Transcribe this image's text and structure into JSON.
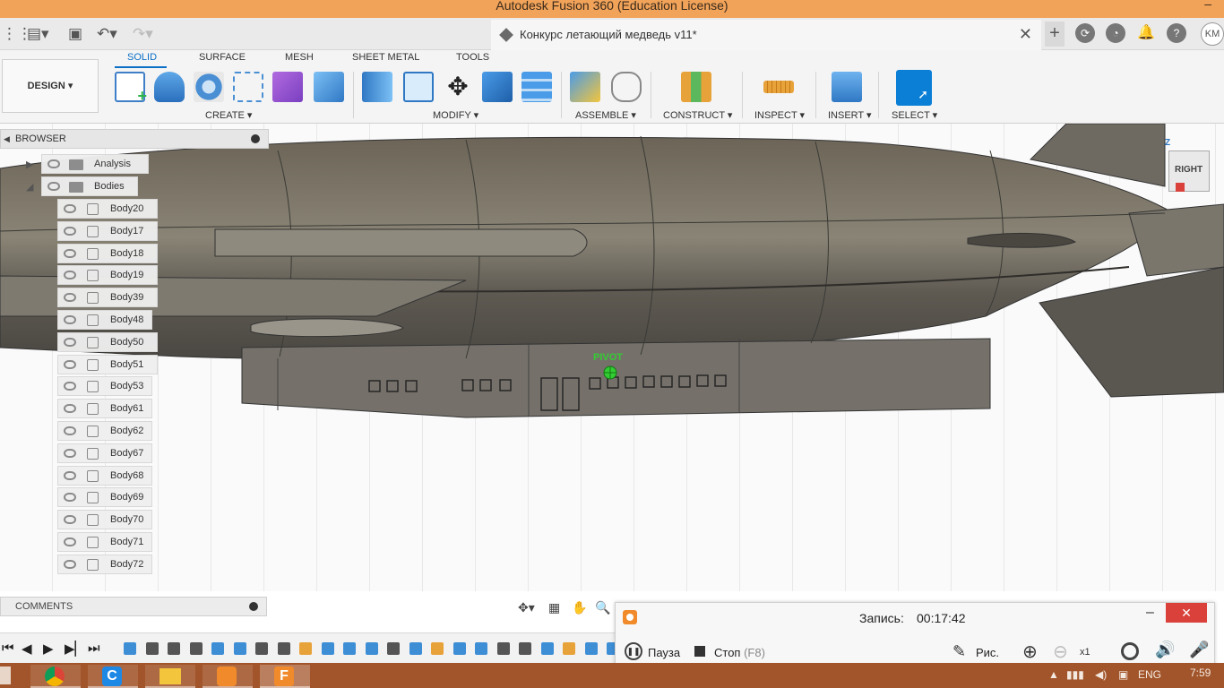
{
  "window": {
    "title": "Autodesk Fusion 360 (Education License)",
    "minimize": "–"
  },
  "document_tab": {
    "name": "Конкурс летающий медведь v11*",
    "close": "✕"
  },
  "user": {
    "initials": "KM"
  },
  "ribbon": {
    "workspace": "DESIGN ▾",
    "tabs": [
      "SOLID",
      "SURFACE",
      "MESH",
      "SHEET METAL",
      "TOOLS"
    ],
    "groups": [
      "CREATE ▾",
      "MODIFY ▾",
      "ASSEMBLE ▾",
      "CONSTRUCT ▾",
      "INSPECT ▾",
      "INSERT ▾",
      "SELECT ▾"
    ]
  },
  "browser": {
    "title": "BROWSER",
    "folders": [
      "Analysis",
      "Bodies"
    ],
    "bodies": [
      "Body20",
      "Body17",
      "Body18",
      "Body19",
      "Body39",
      "Body48",
      "Body50",
      "Body51",
      "Body53",
      "Body61",
      "Body62",
      "Body67",
      "Body68",
      "Body69",
      "Body70",
      "Body71",
      "Body72"
    ]
  },
  "viewport": {
    "pivot_label": "PIVOT",
    "viewcube_label": "RIGHT",
    "axis_z": "Z"
  },
  "comments": {
    "title": "COMMENTS"
  },
  "recorder": {
    "rec_label": "Запись:",
    "rec_time": "00:17:42",
    "pause": "Пауза",
    "stop": "Стоп",
    "stop_key": "(F8)",
    "draw": "Рис.",
    "zoom": "x1",
    "close": "✕",
    "minimize": "–"
  },
  "taskbar": {
    "lang": "ENG",
    "time": "7:59"
  },
  "colors": {
    "accent": "#0b6fc6",
    "titlebar": "#f1a35a",
    "taskbar": "#a2552a",
    "close_red": "#d9413a",
    "pivot": "#33cc33"
  }
}
